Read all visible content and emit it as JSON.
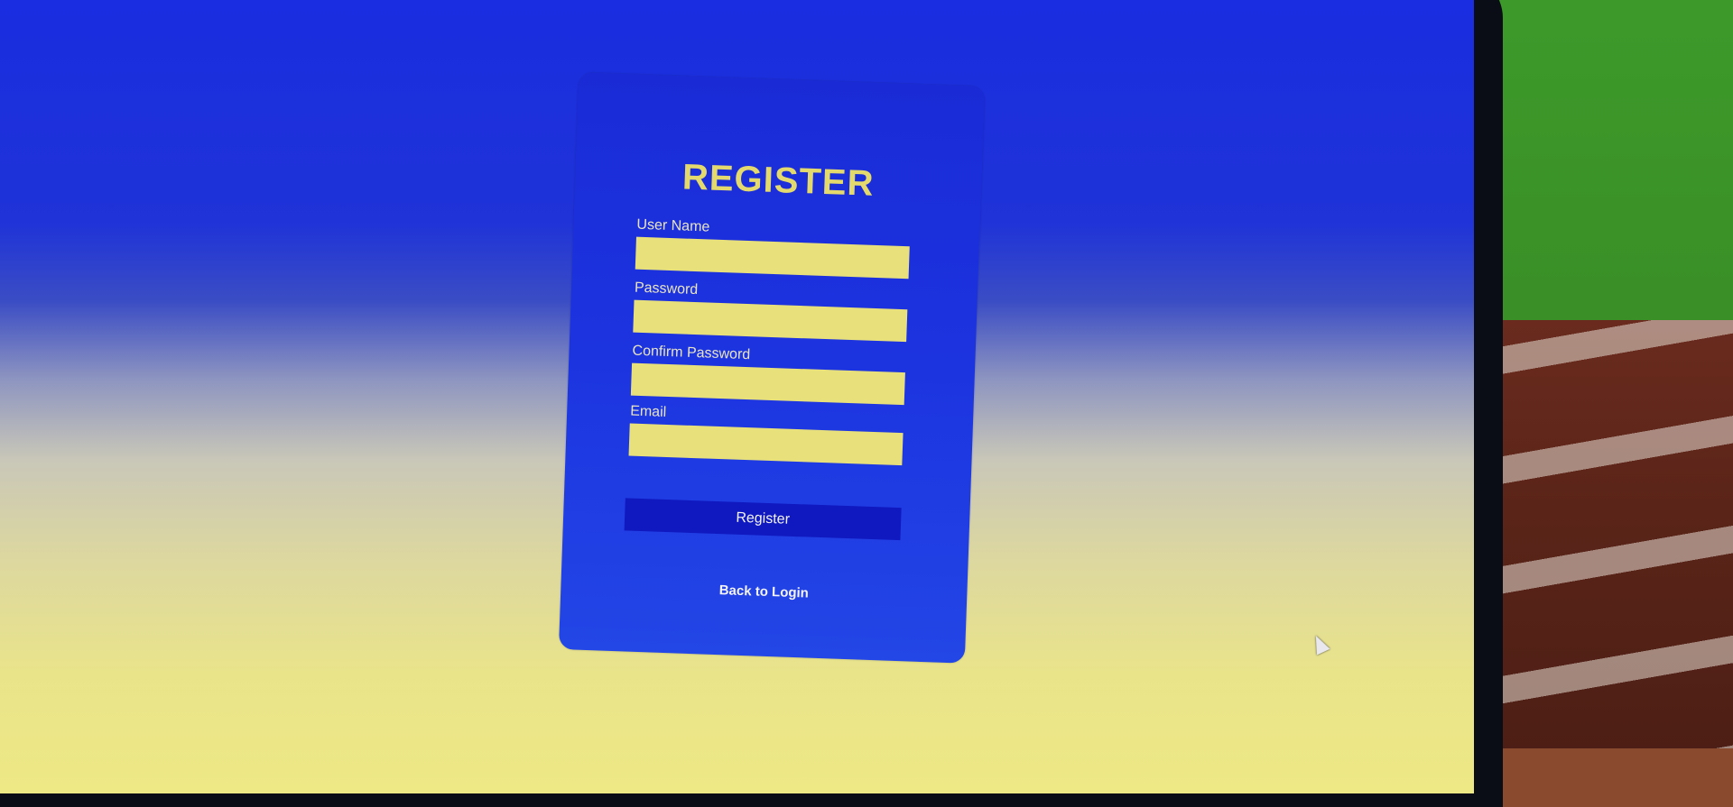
{
  "form": {
    "title": "REGISTER",
    "fields": [
      {
        "label": "User Name",
        "value": "",
        "placeholder": ""
      },
      {
        "label": "Password",
        "value": "",
        "placeholder": ""
      },
      {
        "label": "Confirm Password",
        "value": "",
        "placeholder": ""
      },
      {
        "label": "Email",
        "value": "",
        "placeholder": ""
      }
    ],
    "submit_label": "Register",
    "back_link": "Back to Login"
  },
  "colors": {
    "card_background": "#1c34e0",
    "title": "#e3d96c",
    "input_background": "#e8e07a",
    "button_background": "#1019c0",
    "page_gradient_top": "#1a2de0",
    "page_gradient_bottom": "#eee885"
  },
  "icons": {
    "cursor": "mouse-pointer-icon"
  }
}
